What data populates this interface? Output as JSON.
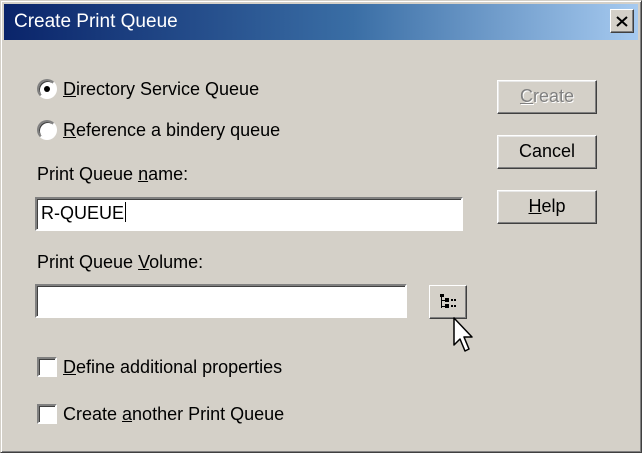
{
  "window": {
    "title": "Create Print Queue",
    "close_icon": "close-icon"
  },
  "queue_type": {
    "options": [
      {
        "before": "",
        "accel": "D",
        "after": "irectory Service Queue",
        "selected": true
      },
      {
        "before": "",
        "accel": "R",
        "after": "eference a bindery queue",
        "selected": false
      }
    ]
  },
  "name_field": {
    "label_before": "Print Queue ",
    "label_accel": "n",
    "label_after": "ame:",
    "value": "R-QUEUE"
  },
  "volume_field": {
    "label_before": "Print Queue ",
    "label_accel": "V",
    "label_after": "olume:",
    "value": "",
    "browse_icon": "directory-tree-browse-icon"
  },
  "options": {
    "define_properties": {
      "before": "",
      "accel": "D",
      "after": "efine additional properties",
      "checked": false
    },
    "create_another": {
      "before": "Create ",
      "accel": "a",
      "after": "nother Print Queue",
      "checked": false
    }
  },
  "buttons": {
    "create": {
      "accel": "C",
      "after": "reate",
      "enabled": false
    },
    "cancel": {
      "label": "Cancel"
    },
    "help": {
      "accel": "H",
      "after": "elp"
    }
  },
  "colors": {
    "title_start": "#0a246a",
    "title_end": "#a6caf0",
    "face": "#d4d0c8",
    "disabled_text": "#808080"
  },
  "cursor_icon": "mouse-pointer-icon"
}
